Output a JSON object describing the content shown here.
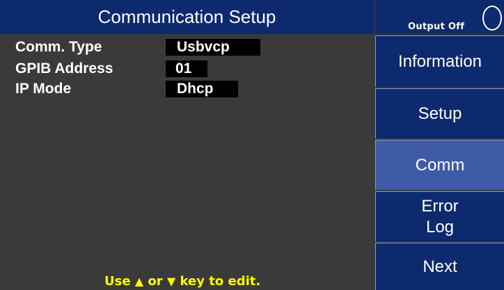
{
  "header": {
    "title": "Communication Setup",
    "output_status": "Output Off"
  },
  "params": [
    {
      "label": "Comm. Type",
      "value": "Usbvcp"
    },
    {
      "label": "GPIB Address",
      "value": "01"
    },
    {
      "label": "IP Mode",
      "value": "Dhcp"
    }
  ],
  "hint": {
    "prefix": "Use",
    "up_arrow": "▲",
    "middle": "or",
    "down_arrow": "▼",
    "suffix": "key to edit."
  },
  "softkeys": {
    "information": "Information",
    "setup": "Setup",
    "comm": "Comm",
    "error_log_line1": "Error",
    "error_log_line2": "Log",
    "next": "Next"
  },
  "colors": {
    "background": "#3a3a3a",
    "panel_blue": "#0d2a6e",
    "active_softkey": "#3f5ba8",
    "hint_yellow": "#ffff00",
    "value_field": "#000000"
  },
  "icons": {
    "output_indicator": "output-indicator-icon",
    "up_arrow": "up-arrow-icon",
    "down_arrow": "down-arrow-icon"
  }
}
